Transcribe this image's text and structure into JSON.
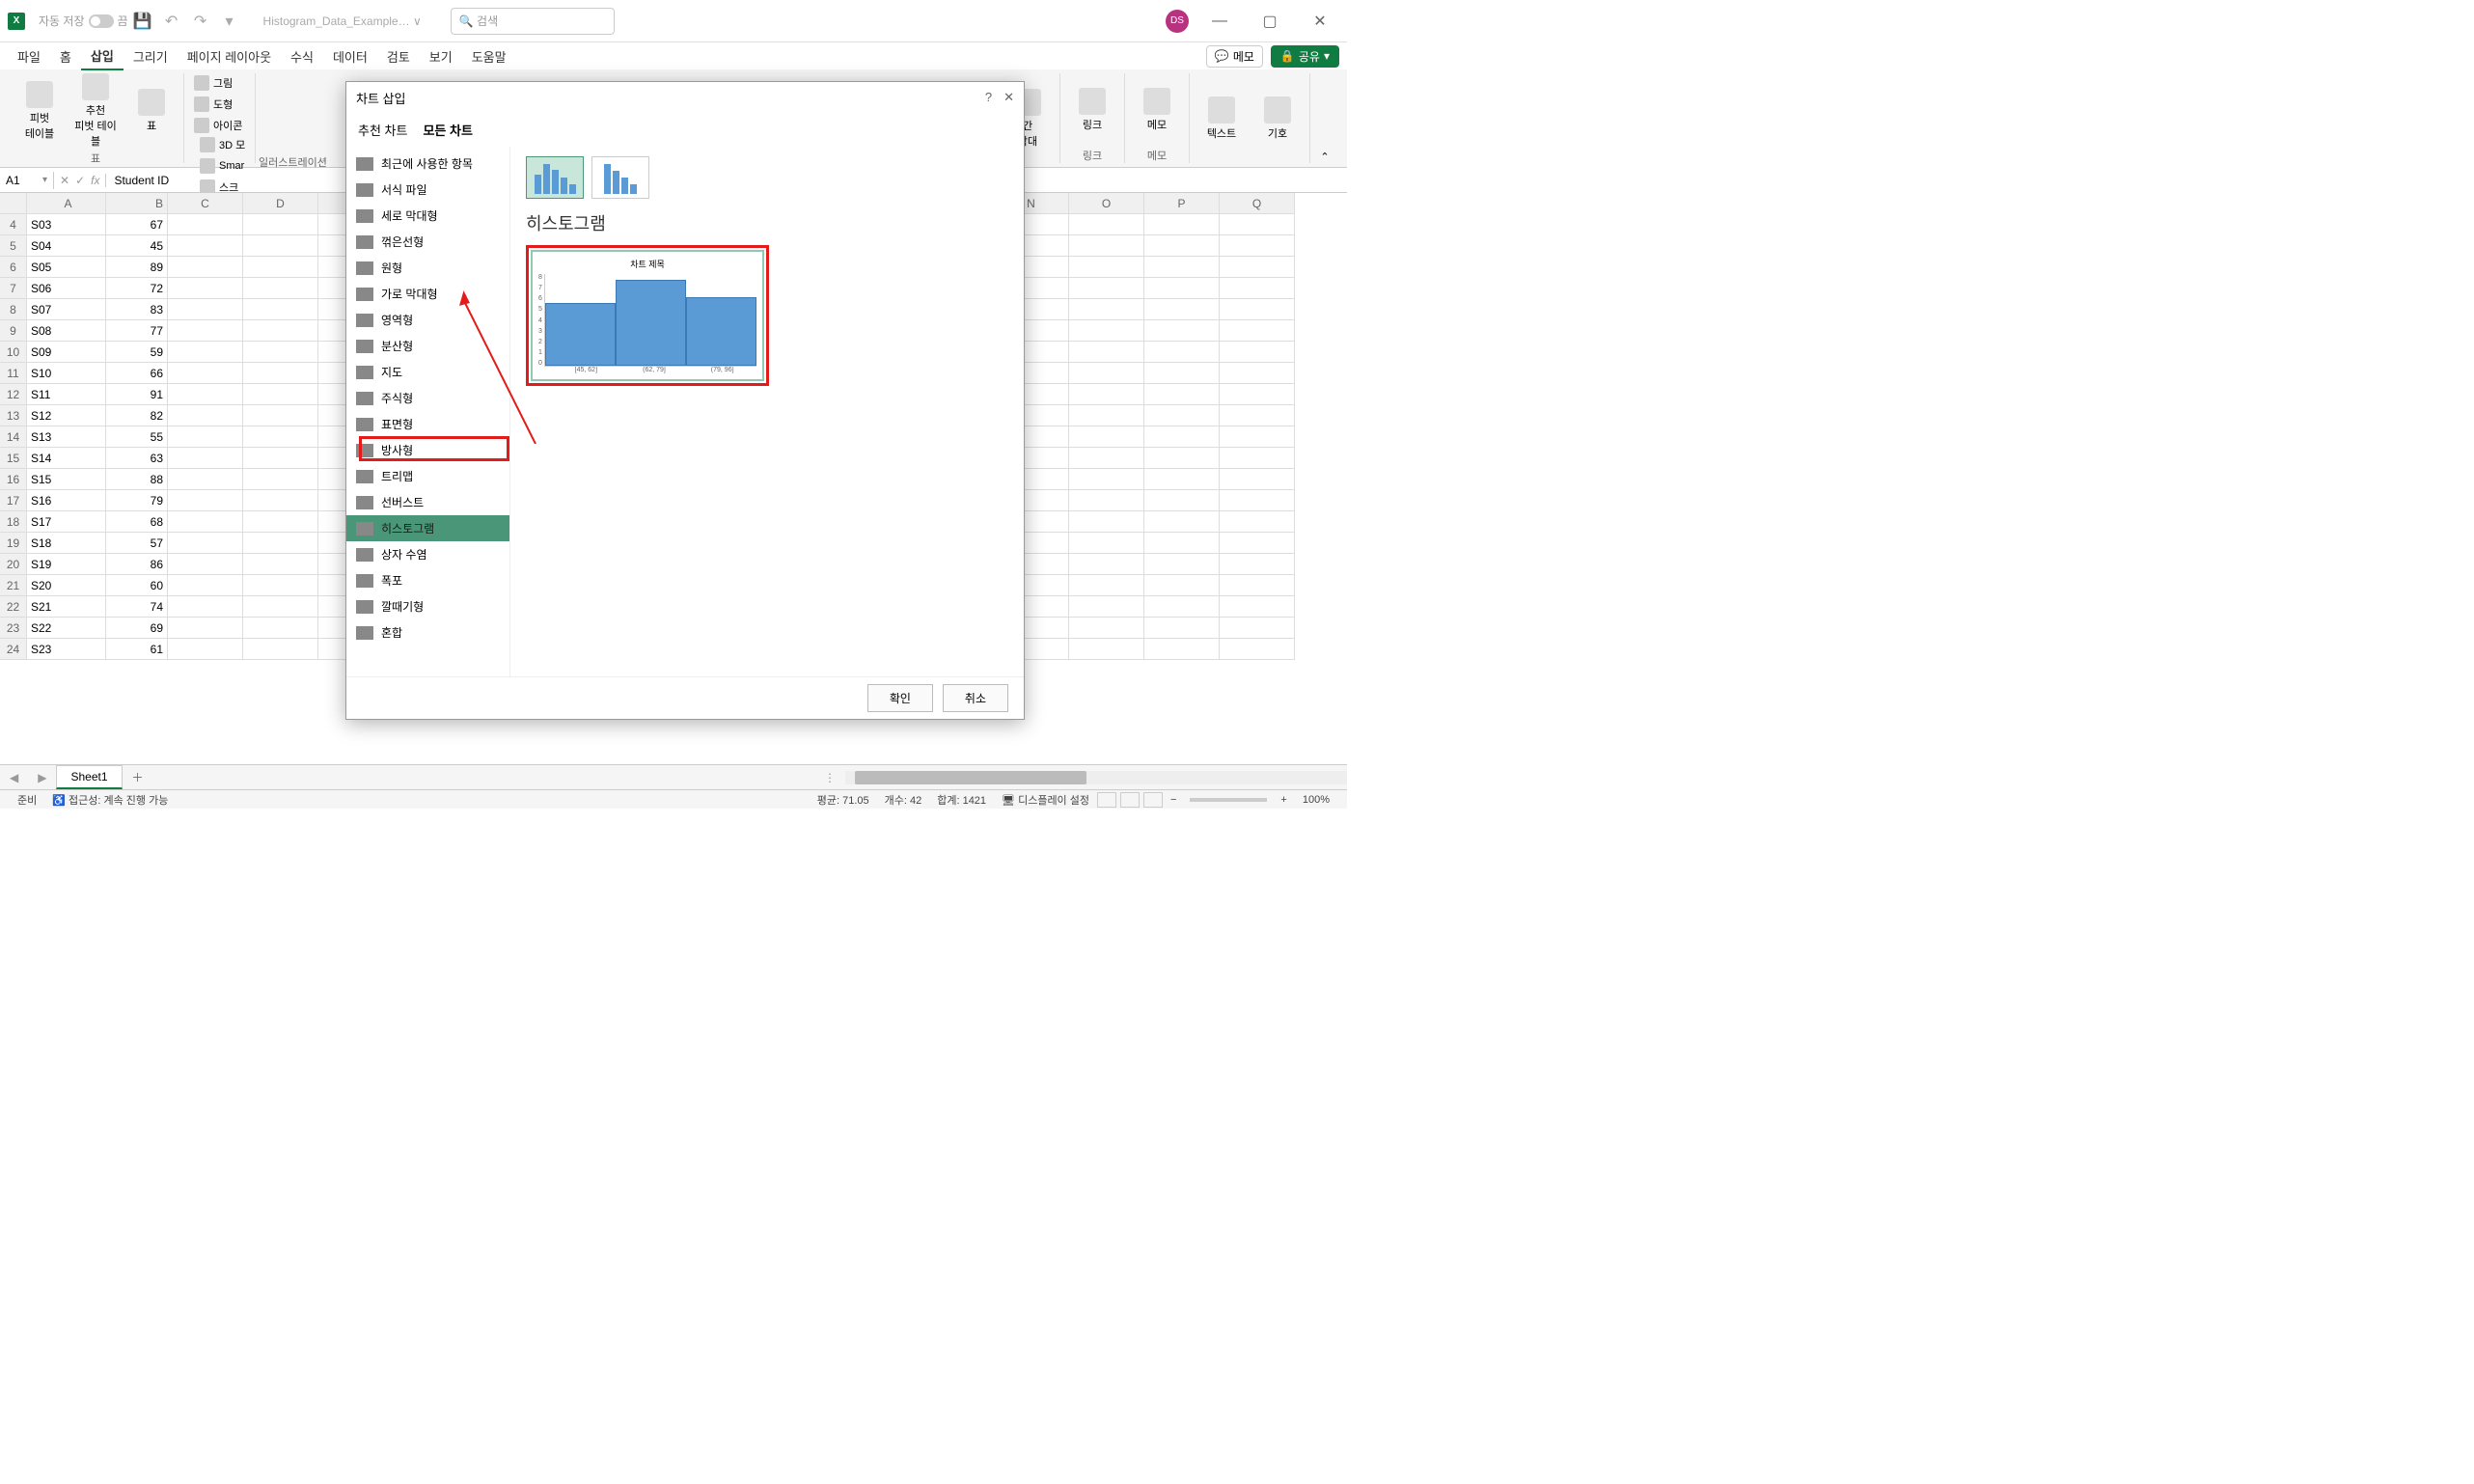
{
  "titlebar": {
    "autosave_label": "자동 저장",
    "autosave_state": "끔",
    "filename": "Histogram_Data_Example… ∨",
    "search_placeholder": "검색",
    "avatar": "DS"
  },
  "ribbon_tabs": [
    "파일",
    "홈",
    "삽입",
    "그리기",
    "페이지 레이아웃",
    "수식",
    "데이터",
    "검토",
    "보기",
    "도움말"
  ],
  "ribbon_active_tab": "삽입",
  "ribbon_right": {
    "memo": "메모",
    "share": "공유"
  },
  "ribbon_groups": {
    "tables": {
      "pivot": "피벗\n테이블",
      "rec_pivot": "추천\n피벗 테이블",
      "table": "표",
      "label": "표"
    },
    "illust": {
      "items": [
        "그림",
        "3D 모",
        "도형",
        "Smar",
        "아이콘",
        "스크"
      ],
      "label": "일러스트레이션"
    },
    "link": {
      "link": "링크",
      "label": "링크"
    },
    "memo": {
      "memo": "메모",
      "label": "메모"
    },
    "text": {
      "text": "텍스트",
      "sym": "기호"
    },
    "bar": "간\n막대"
  },
  "name_box": "A1",
  "formula_value": "Student ID",
  "columns": [
    "A",
    "B",
    "C",
    "D",
    "N",
    "O",
    "P",
    "Q"
  ],
  "rows": [
    {
      "n": 4,
      "a": "S03",
      "b": 67
    },
    {
      "n": 5,
      "a": "S04",
      "b": 45
    },
    {
      "n": 6,
      "a": "S05",
      "b": 89
    },
    {
      "n": 7,
      "a": "S06",
      "b": 72
    },
    {
      "n": 8,
      "a": "S07",
      "b": 83
    },
    {
      "n": 9,
      "a": "S08",
      "b": 77
    },
    {
      "n": 10,
      "a": "S09",
      "b": 59
    },
    {
      "n": 11,
      "a": "S10",
      "b": 66
    },
    {
      "n": 12,
      "a": "S11",
      "b": 91
    },
    {
      "n": 13,
      "a": "S12",
      "b": 82
    },
    {
      "n": 14,
      "a": "S13",
      "b": 55
    },
    {
      "n": 15,
      "a": "S14",
      "b": 63
    },
    {
      "n": 16,
      "a": "S15",
      "b": 88
    },
    {
      "n": 17,
      "a": "S16",
      "b": 79
    },
    {
      "n": 18,
      "a": "S17",
      "b": 68
    },
    {
      "n": 19,
      "a": "S18",
      "b": 57
    },
    {
      "n": 20,
      "a": "S19",
      "b": 86
    },
    {
      "n": 21,
      "a": "S20",
      "b": 60
    },
    {
      "n": 22,
      "a": "S21",
      "b": 74
    },
    {
      "n": 23,
      "a": "S22",
      "b": 69
    },
    {
      "n": 24,
      "a": "S23",
      "b": 61
    }
  ],
  "sheet_tab": "Sheet1",
  "status": {
    "ready": "준비",
    "accessibility": "접근성: 계속 진행 가능",
    "avg": "평균: 71.05",
    "count": "개수: 42",
    "sum": "합계: 1421",
    "display": "디스플레이 설정",
    "zoom": "100%"
  },
  "dialog": {
    "title": "차트 삽입",
    "tabs": [
      "추천 차트",
      "모든 차트"
    ],
    "chart_types": [
      "최근에 사용한 항목",
      "서식 파일",
      "세로 막대형",
      "꺾은선형",
      "원형",
      "가로 막대형",
      "영역형",
      "분산형",
      "지도",
      "주식형",
      "표면형",
      "방사형",
      "트리맵",
      "선버스트",
      "히스토그램",
      "상자 수염",
      "폭포",
      "깔때기형",
      "혼합"
    ],
    "selected_type": "히스토그램",
    "preview_label": "히스토그램",
    "preview_chart_title": "차트 제목",
    "ok": "확인",
    "cancel": "취소"
  },
  "chart_data": {
    "type": "bar",
    "title": "차트 제목",
    "categories": [
      "[45, 62]",
      "(62, 79]",
      "(79, 96]"
    ],
    "values": [
      5.5,
      7.5,
      6
    ],
    "ylim": [
      0,
      8
    ],
    "yticks": [
      0,
      1,
      2,
      3,
      4,
      5,
      6,
      7,
      8
    ]
  }
}
